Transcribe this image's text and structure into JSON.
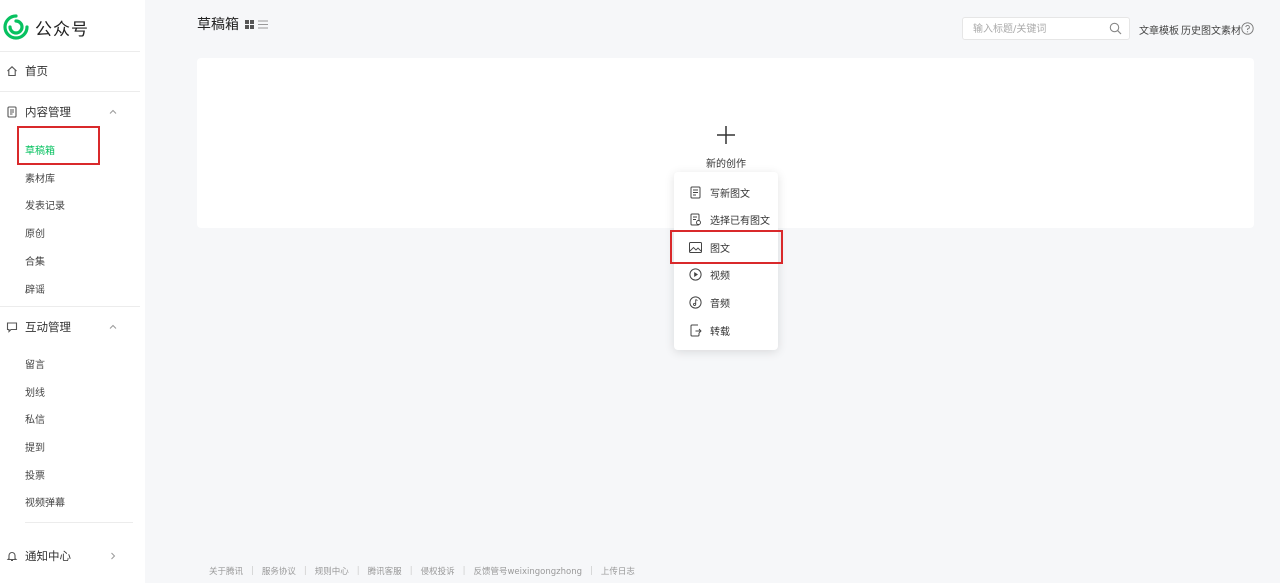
{
  "app": {
    "name": "公众号"
  },
  "sidebar": {
    "home": "首页",
    "content_group": {
      "label": "内容管理",
      "items": [
        "草稿箱",
        "素材库",
        "发表记录",
        "原创",
        "合集",
        "辟谣"
      ],
      "active": "草稿箱"
    },
    "interaction_group": {
      "label": "互动管理",
      "items": [
        "留言",
        "划线",
        "私信",
        "提到",
        "投票",
        "视频弹幕"
      ]
    },
    "notifications": "通知中心"
  },
  "header": {
    "title": "草稿箱",
    "search_placeholder": "输入标题/关键词",
    "links": [
      "文章模板",
      "历史图文素材"
    ]
  },
  "main": {
    "new_creation_label": "新的创作",
    "menu": [
      {
        "label": "写新图文",
        "icon": "document-icon"
      },
      {
        "label": "选择已有图文",
        "icon": "document-search-icon"
      },
      {
        "label": "图文",
        "icon": "image-icon"
      },
      {
        "label": "视频",
        "icon": "play-icon"
      },
      {
        "label": "音频",
        "icon": "audio-icon"
      },
      {
        "label": "转载",
        "icon": "repost-icon"
      }
    ]
  },
  "footer": {
    "links": [
      "关于腾讯",
      "服务协议",
      "规则中心",
      "腾讯客服",
      "侵权投诉",
      "反馈管号weixingongzhong",
      "上传日志"
    ]
  },
  "colors": {
    "accent": "#07c160",
    "highlight": "#d9292b",
    "background": "#f6f7f9"
  }
}
